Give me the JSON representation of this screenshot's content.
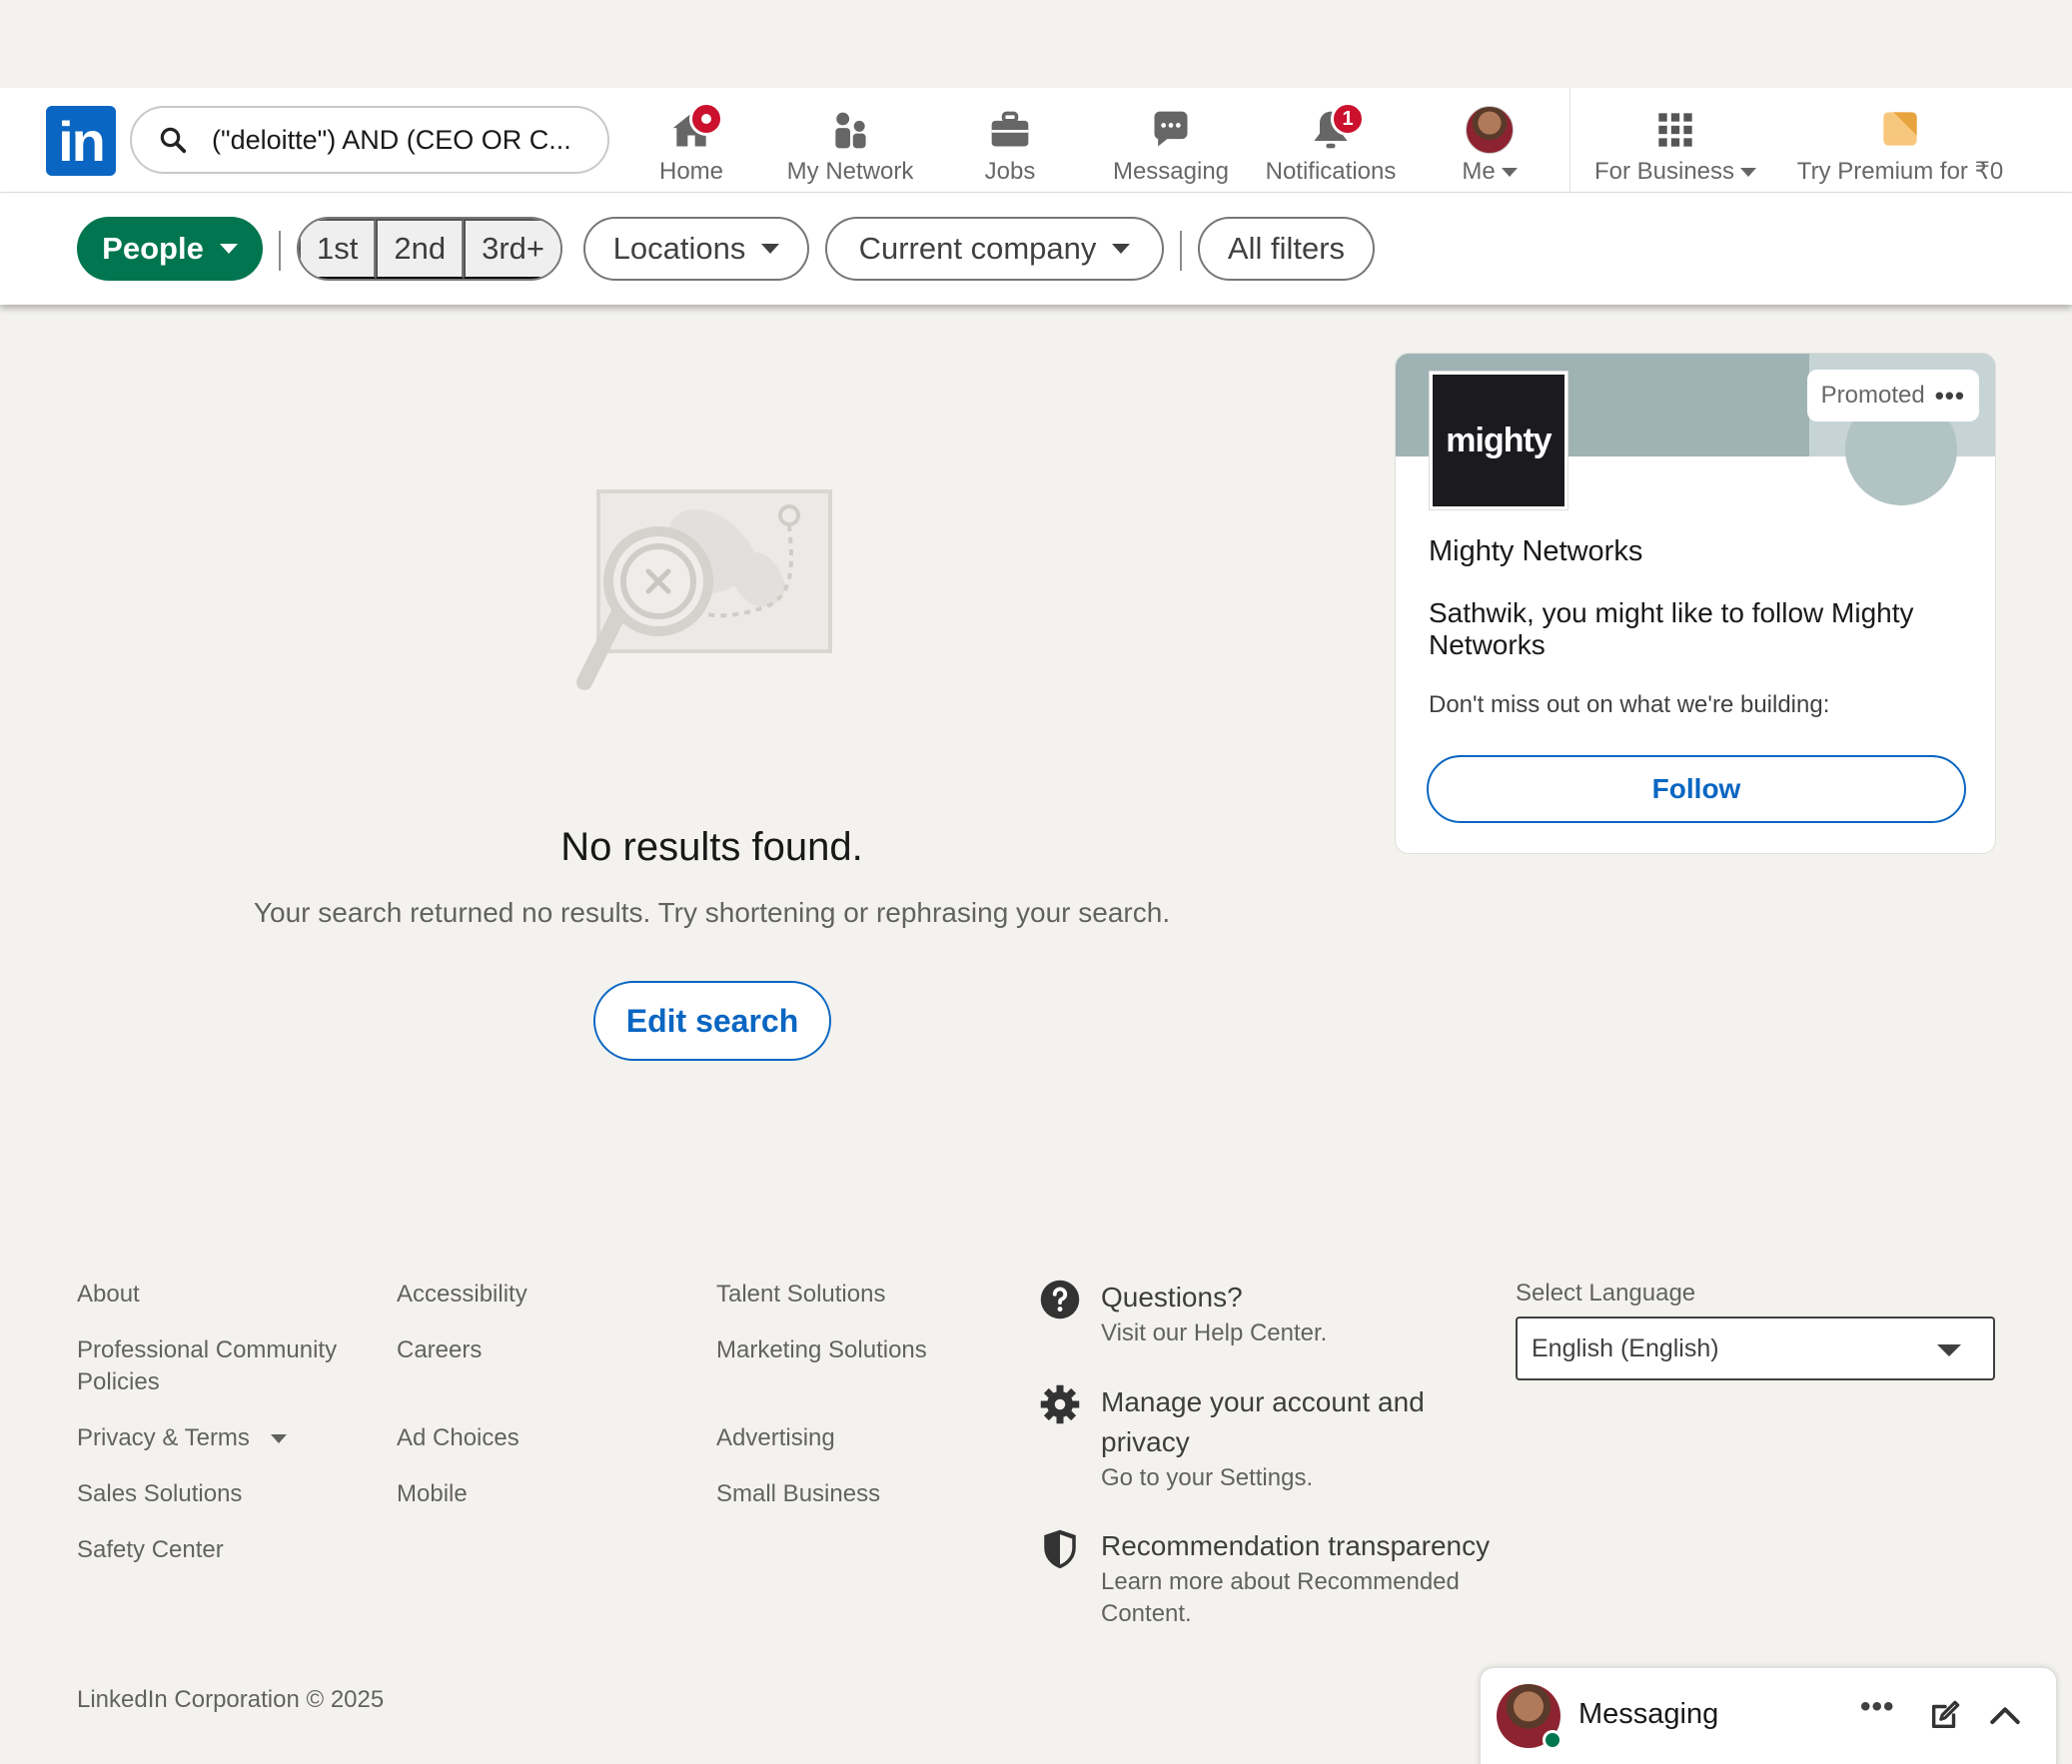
{
  "nav": {
    "logo_text": "in",
    "search_value": "(\"deloitte\") AND (CEO OR C...",
    "items": [
      {
        "label": "Home",
        "icon": "home-icon",
        "badge": "dot"
      },
      {
        "label": "My Network",
        "icon": "people-icon"
      },
      {
        "label": "Jobs",
        "icon": "briefcase-icon"
      },
      {
        "label": "Messaging",
        "icon": "chat-icon"
      },
      {
        "label": "Notifications",
        "icon": "bell-icon",
        "badge": "1"
      },
      {
        "label": "Me",
        "icon": "avatar"
      },
      {
        "label": "For Business",
        "icon": "grid-icon"
      },
      {
        "label": "Try Premium for ₹0",
        "icon": "premium-icon"
      }
    ]
  },
  "filters": {
    "people": "People",
    "degrees": [
      "1st",
      "2nd",
      "3rd+"
    ],
    "locations": "Locations",
    "current_company": "Current company",
    "all_filters": "All filters"
  },
  "empty": {
    "title": "No results found.",
    "subtitle": "Your search returned no results. Try shortening or rephrasing your search.",
    "button": "Edit search"
  },
  "ad": {
    "promoted": "Promoted",
    "logo_text": "mighty",
    "company": "Mighty Networks",
    "text": "Sathwik, you might like to follow Mighty Networks",
    "subtext": "Don't miss out on what we're building:",
    "follow": "Follow"
  },
  "footer": {
    "col1": [
      "About",
      "Professional Community Policies",
      "Privacy & Terms",
      "Sales Solutions",
      "Safety Center"
    ],
    "col2": [
      "Accessibility",
      "Careers",
      "Ad Choices",
      "Mobile"
    ],
    "col3": [
      "Talent Solutions",
      "Marketing Solutions",
      "Advertising",
      "Small Business"
    ],
    "help": [
      {
        "title": "Questions?",
        "sub": "Visit our Help Center.",
        "icon": "question-icon"
      },
      {
        "title": "Manage your account and privacy",
        "sub": "Go to your Settings.",
        "icon": "gear-icon"
      },
      {
        "title": "Recommendation transparency",
        "sub": "Learn more about Recommended Content.",
        "icon": "shield-icon"
      }
    ],
    "language_label": "Select Language",
    "language_value": "English (English)",
    "copyright": "LinkedIn Corporation © 2025"
  },
  "messaging_dock": {
    "title": "Messaging"
  },
  "colors": {
    "brand": "#0a66c2",
    "people_pill": "#01754f",
    "badge": "#cb112d",
    "page_bg": "#f3f2ef"
  }
}
